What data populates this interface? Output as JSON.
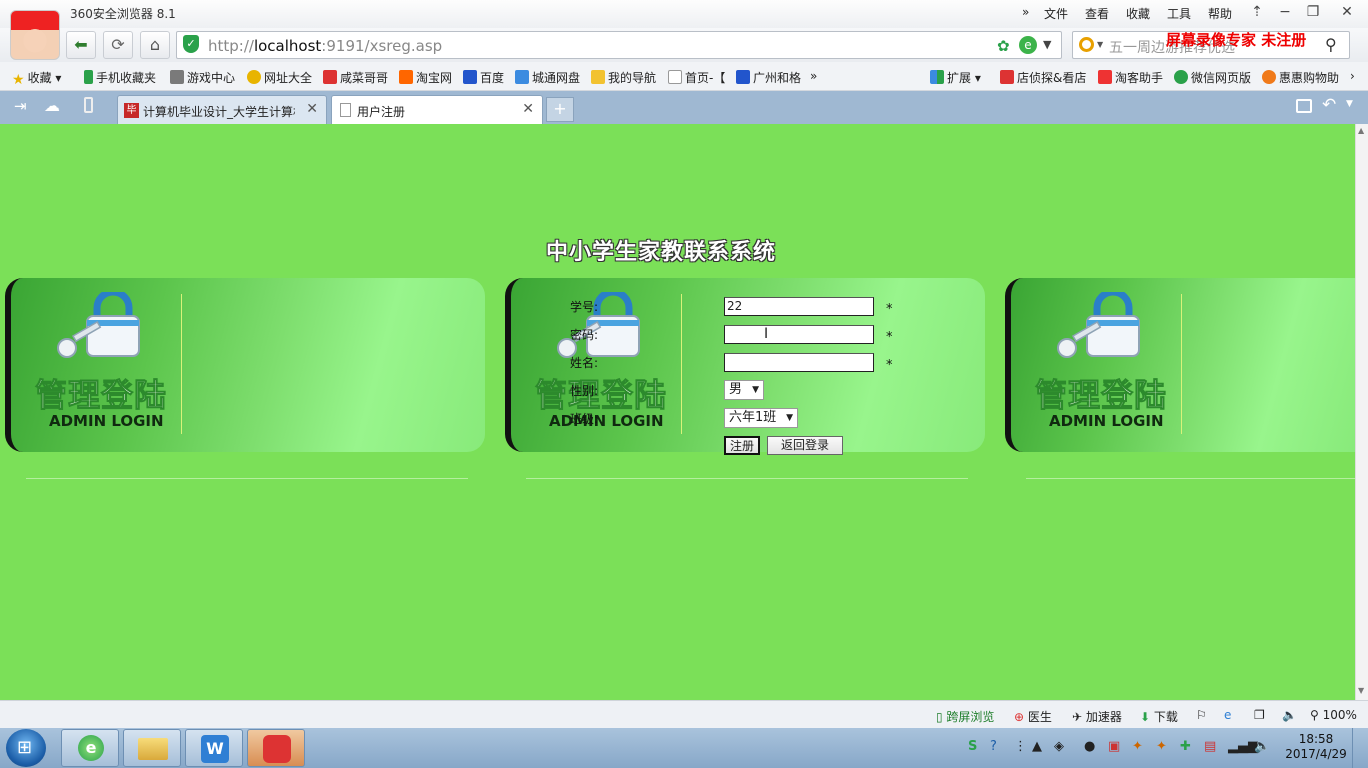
{
  "browser": {
    "title": "360安全浏览器 8.1",
    "menu": [
      "文件",
      "查看",
      "收藏",
      "工具",
      "帮助"
    ],
    "address": {
      "protocol": "http://",
      "host": "localhost",
      "rest": ":9191/xsreg.asp"
    },
    "search_placeholder": "五一周边游推荐优选",
    "watermark": "屏幕录像专家  未注册"
  },
  "bookmarks": {
    "favorites": "收藏",
    "items": [
      "手机收藏夹",
      "游戏中心",
      "网址大全",
      "咸菜哥哥",
      "淘宝网",
      "百度",
      "城通网盘",
      "我的导航",
      "首页-【",
      "广州和格"
    ],
    "more": "»",
    "extensions": "扩展",
    "right_items": [
      "店侦探&看店",
      "淘客助手",
      "微信网页版",
      "惠惠购物助"
    ]
  },
  "tabs": [
    {
      "label": "计算机毕业设计_大学生计算机",
      "active": false
    },
    {
      "label": "用户注册",
      "active": true
    }
  ],
  "page": {
    "system_title": "中小学生家教联系系统",
    "admin_login_cn": "管理登陆",
    "admin_login_en": "ADMIN LOGIN",
    "form": {
      "student_id_label": "学号:",
      "student_id_value": "22",
      "password_label": "密码:",
      "name_label": "姓名:",
      "gender_label": "性别:",
      "gender_value": "男",
      "class_label": "班级:",
      "class_value": "六年1班",
      "required_mark": "*",
      "register_button": "注册",
      "back_button": "返回登录"
    }
  },
  "statusbar": {
    "items": [
      "跨屏浏览",
      "医生",
      "加速器",
      "下载"
    ],
    "zoom": "100%"
  },
  "taskbar": {
    "time": "18:58",
    "date": "2017/4/29"
  }
}
